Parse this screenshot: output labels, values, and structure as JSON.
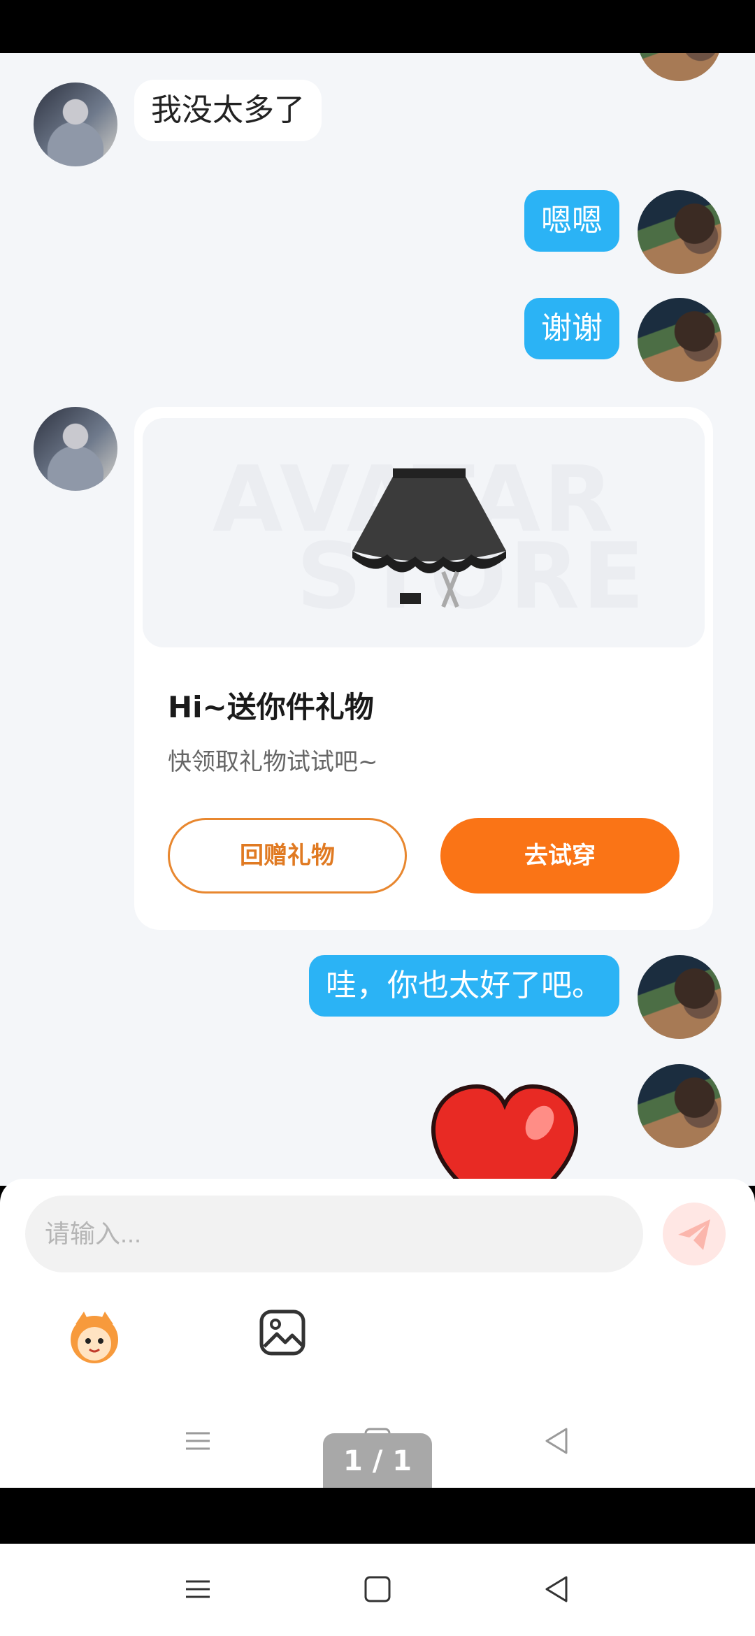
{
  "messages": [
    {
      "side": "left",
      "type": "text",
      "text": "我没太多了"
    },
    {
      "side": "right",
      "type": "text",
      "text": "嗯嗯"
    },
    {
      "side": "right",
      "type": "text",
      "text": "谢谢"
    },
    {
      "side": "left",
      "type": "gift"
    },
    {
      "side": "right",
      "type": "text",
      "text": "哇，你也太好了吧。"
    },
    {
      "side": "right",
      "type": "sticker",
      "sticker": "heart-sticker"
    }
  ],
  "gift_card": {
    "watermark_line1": "AVATAR",
    "watermark_line2": "STORE",
    "title": "Hi~送你件礼物",
    "subtitle": "快领取礼物试试吧~",
    "return_gift_label": "回赠礼物",
    "try_on_label": "去试穿"
  },
  "composer": {
    "placeholder": "请输入...",
    "send_icon": "send-icon",
    "sticker_icon": "sticker-icon",
    "image_icon": "image-icon"
  },
  "page_indicator": "1 / 1",
  "colors": {
    "chat_bg": "#f4f6f9",
    "self_bubble": "#2bb3f5",
    "accent_orange": "#fa7416"
  }
}
